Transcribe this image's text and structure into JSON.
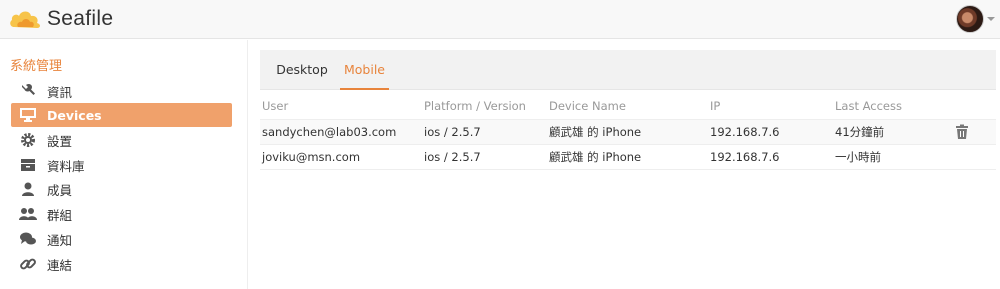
{
  "header": {
    "brand": "Seafile",
    "logo_icon": "seafile-cloud-logo",
    "avatar_icon": "user-avatar"
  },
  "sidebar": {
    "title": "系統管理",
    "items": [
      {
        "label": "資訊",
        "icon": "wrench-icon",
        "active": false
      },
      {
        "label": "Devices",
        "icon": "monitor-icon",
        "active": true
      },
      {
        "label": "設置",
        "icon": "gear-icon",
        "active": false
      },
      {
        "label": "資料庫",
        "icon": "drawer-icon",
        "active": false
      },
      {
        "label": "成員",
        "icon": "user-icon",
        "active": false
      },
      {
        "label": "群組",
        "icon": "group-icon",
        "active": false
      },
      {
        "label": "通知",
        "icon": "chat-icon",
        "active": false
      },
      {
        "label": "連結",
        "icon": "link-icon",
        "active": false
      }
    ]
  },
  "tabs": [
    {
      "label": "Desktop",
      "active": false
    },
    {
      "label": "Mobile",
      "active": true
    }
  ],
  "table": {
    "headers": [
      "User",
      "Platform / Version",
      "Device Name",
      "IP",
      "Last Access"
    ],
    "rows": [
      {
        "user": "sandychen@lab03.com",
        "platform": "ios / 2.5.7",
        "device": "顧武雄 的 iPhone",
        "ip": "192.168.7.6",
        "last_access": "41分鐘前",
        "delete_icon": "trash-icon"
      },
      {
        "user": "joviku@msn.com",
        "platform": "ios / 2.5.7",
        "device": "顧武雄 的 iPhone",
        "ip": "192.168.7.6",
        "last_access": "一小時前"
      }
    ]
  },
  "colors": {
    "accent": "#e8843c",
    "active_bg": "#f0a16b"
  }
}
